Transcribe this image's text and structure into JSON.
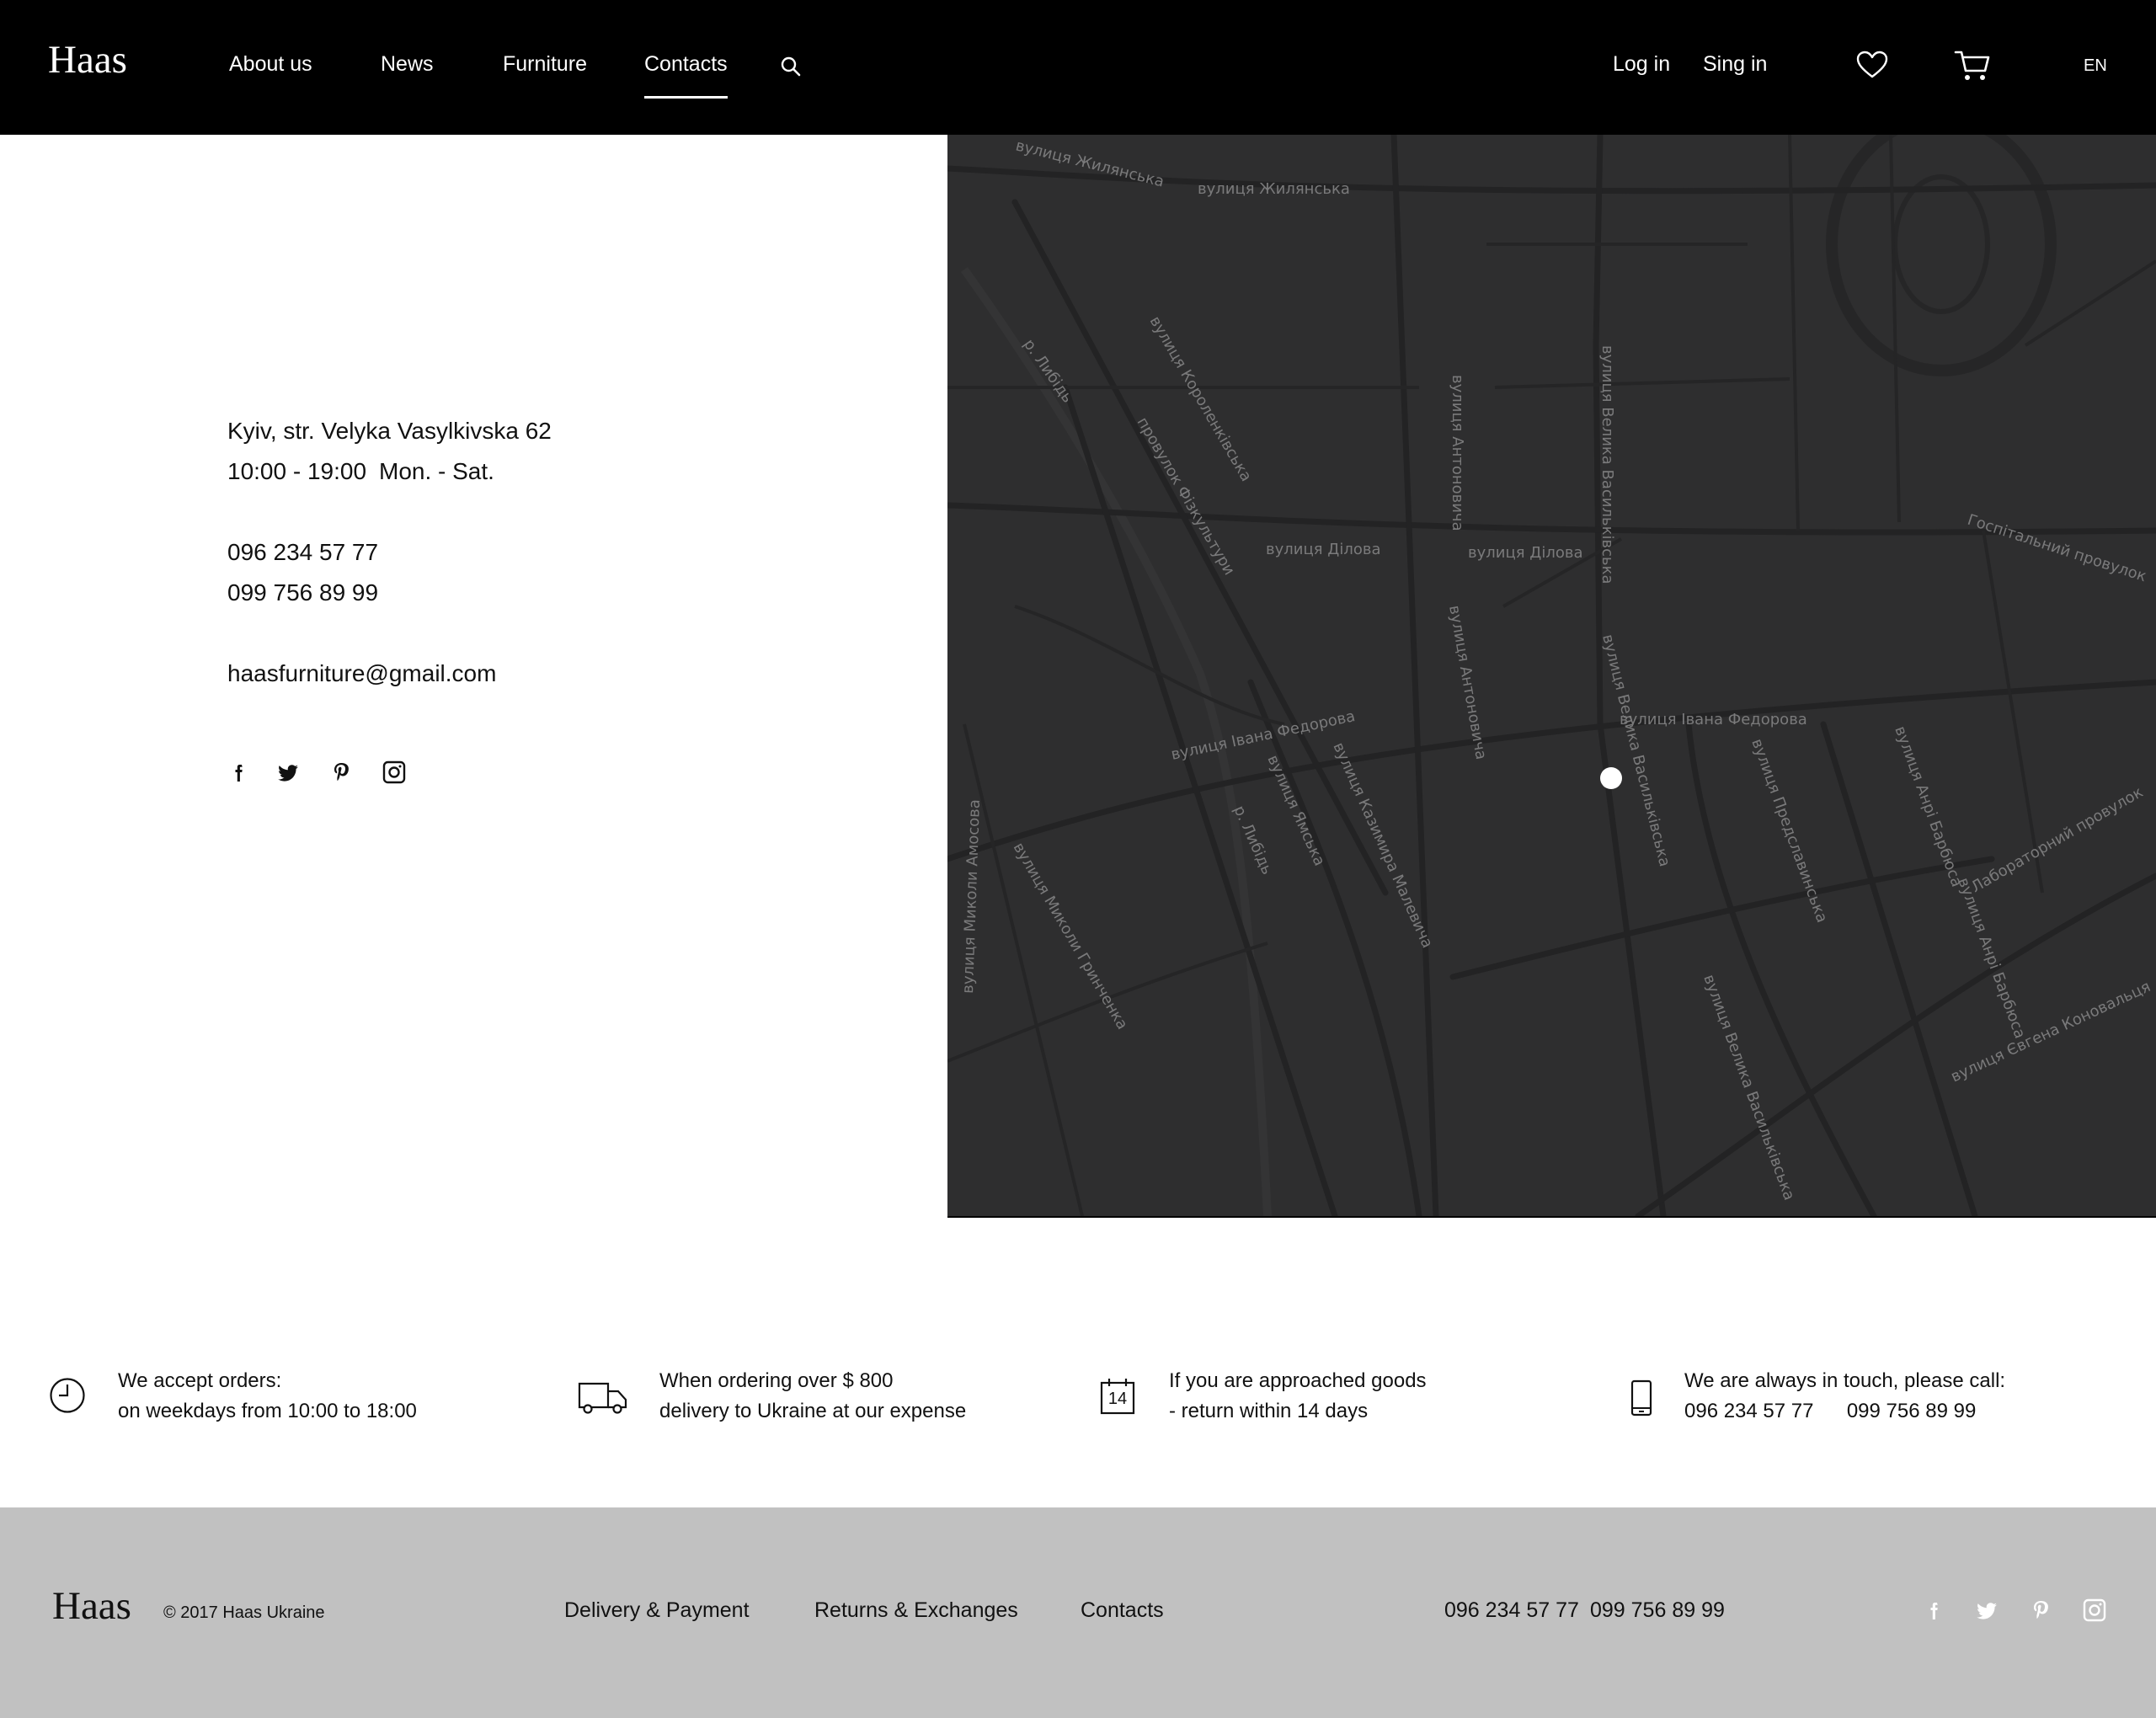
{
  "header": {
    "logo": "Haas",
    "nav": [
      "About us",
      "News",
      "Furniture",
      "Contacts"
    ],
    "active_nav": "Contacts",
    "login": "Log in",
    "signin": "Sing in",
    "lang": "EN"
  },
  "contact": {
    "address": "Kyiv, str. Velyka Vasylkivska 62",
    "hours": "10:00 - 19:00",
    "days": "Mon. - Sat.",
    "phone1": "096 234 57 77",
    "phone2": "099 756 89 99",
    "email": "haasfurniture@gmail.com",
    "social": [
      "facebook-icon",
      "twitter-icon",
      "pinterest-icon",
      "instagram-icon"
    ]
  },
  "map": {
    "labels": [
      "вулиця Жилянська",
      "вулиця Жилянська",
      "вулиця Короленківська",
      "провулок Фізкультури",
      "вулиця Ділова",
      "вулиця Ділова",
      "вулиця Антоновича",
      "вулиця Антоновича",
      "вулиця Велика Васильківська",
      "вулиця Велика Васильківська",
      "вулиця Велика Васильківська",
      "вулиця Івана Федорова",
      "вулиця Івана Федорова",
      "вулиця Казимира Малевича",
      "вулиця Ямська",
      "вулиця Миколи Гринченка",
      "вулиця Миколи Амосова",
      "вулиця Предславинська",
      "вулиця Анрі Барбюса",
      "вулиця Анрі Барбюса",
      "Лабораторний провулок",
      "Госпітальний провулок",
      "вулиця Євгена Коновальця",
      "р. Либідь",
      "р. Либідь"
    ]
  },
  "features": [
    {
      "icon": "clock-icon",
      "line1": "We accept orders:",
      "line2": "on weekdays from 10:00 to 18:00"
    },
    {
      "icon": "truck-icon",
      "line1": "When ordering over $ 800",
      "line2": "delivery to Ukraine at our expense"
    },
    {
      "icon": "calendar-icon",
      "day": "14",
      "line1": "If you are approached goods",
      "line2": "- return within 14 days"
    },
    {
      "icon": "phone-icon",
      "line1": "We are always in touch, please call:",
      "line2": "096 234 57 77",
      "line3": "099 756 89 99"
    }
  ],
  "footer": {
    "logo": "Haas",
    "copyright": "© 2017  Haas Ukraine",
    "links": [
      "Delivery & Payment",
      "Returns & Exchanges",
      "Contacts"
    ],
    "phone1": "096 234 57 77",
    "phone2": "099 756 89 99"
  },
  "colors": {
    "header_bg": "#000000",
    "map_bg": "#2e2e2f",
    "footer_bg": "#c1c1c1"
  }
}
